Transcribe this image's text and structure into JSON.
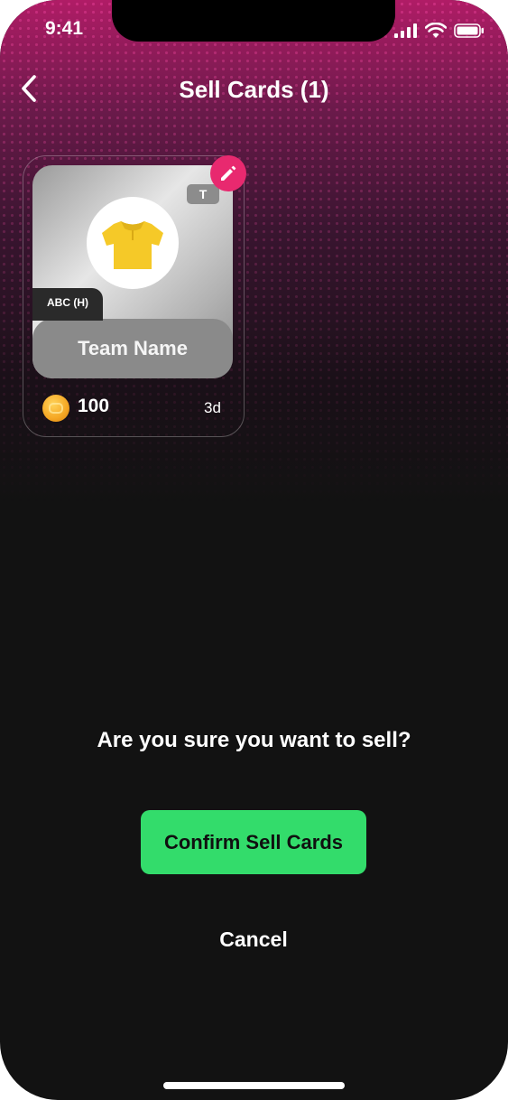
{
  "status_bar": {
    "time": "9:41",
    "icons": [
      "signal-icon",
      "wifi-icon",
      "battery-icon"
    ]
  },
  "header": {
    "title": "Sell Cards (1)",
    "back_icon": "chevron-left-icon"
  },
  "card": {
    "team_name": "Team Name",
    "tag": "ABC (H)",
    "badge": "T",
    "shirt_icon": "jersey-icon",
    "shirt_color": "#f5c928",
    "edit_icon": "pencil-icon",
    "edit_color": "#e8296f",
    "price": "100",
    "duration": "3d",
    "currency_icon": "coin-icon"
  },
  "dialog": {
    "question": "Are you sure you want to sell?",
    "confirm_label": "Confirm Sell Cards",
    "confirm_color": "#33dc6b",
    "cancel_label": "Cancel"
  }
}
